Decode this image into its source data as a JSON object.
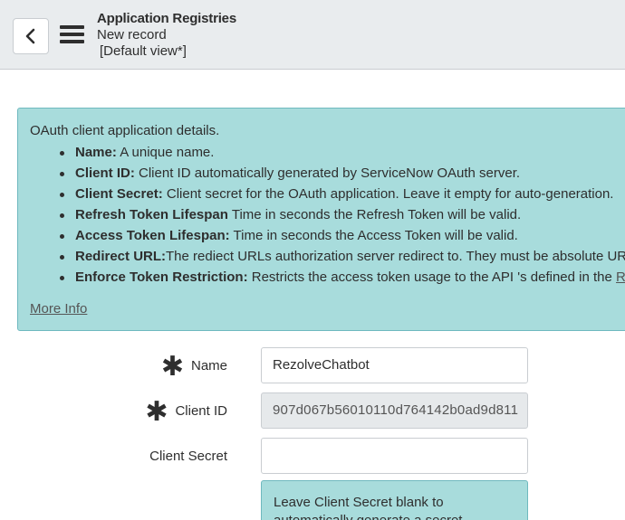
{
  "header": {
    "title": "Application Registries",
    "subtitle": "New record",
    "view": "[Default view*]"
  },
  "info": {
    "intro": "OAuth client application details.",
    "items": [
      {
        "term": "Name:",
        "desc": " A unique name."
      },
      {
        "term": "Client ID:",
        "desc": " Client ID automatically generated by ServiceNow OAuth server."
      },
      {
        "term": "Client Secret:",
        "desc": " Client secret for the OAuth application. Leave it empty for auto-generation."
      },
      {
        "term": "Refresh Token Lifespan",
        "desc": " Time in seconds the Refresh Token will be valid."
      },
      {
        "term": "Access Token Lifespan:",
        "desc": " Time in seconds the Access Token will be valid."
      },
      {
        "term": "Redirect URL:",
        "desc": "The rediect URLs authorization server redirect to. They must be absolute URLs"
      },
      {
        "term": "Enforce Token Restriction:",
        "desc": " Restricts the access token usage to the API 's defined in the ",
        "link": "REST API"
      }
    ],
    "more_info": "More Info"
  },
  "form": {
    "name": {
      "label": "Name",
      "mandatory": "✱",
      "value": "RezolveChatbot"
    },
    "client_id": {
      "label": "Client ID",
      "mandatory": "✱",
      "value": "907d067b56010110d764142b0ad9d811"
    },
    "client_secret": {
      "label": "Client Secret",
      "value": ""
    },
    "hint": "Leave Client Secret blank to automatically generate a secret."
  }
}
